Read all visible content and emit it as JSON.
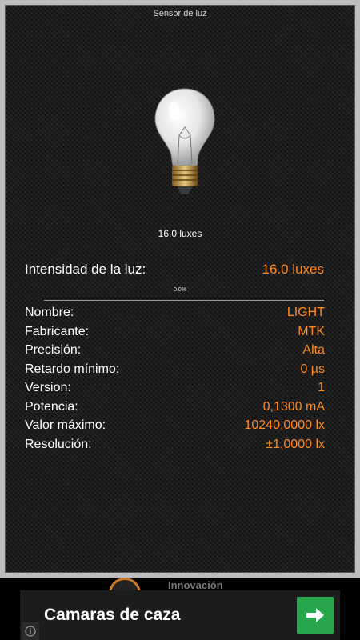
{
  "header": {
    "title": "Sensor de luz"
  },
  "bulb": {
    "caption": "16.0 luxes",
    "icon": "light-bulb-icon"
  },
  "intensity": {
    "label": "Intensidad de la luz:",
    "value": "16.0 luxes",
    "percent_text": "0.0%",
    "percent": 0.0
  },
  "details": [
    {
      "label": "Nombre:",
      "value": "LIGHT"
    },
    {
      "label": "Fabricante:",
      "value": "MTK"
    },
    {
      "label": "Precisión:",
      "value": "Alta"
    },
    {
      "label": "Retardo mínimo:",
      "value": "0 µs"
    },
    {
      "label": "Version:",
      "value": "1"
    },
    {
      "label": "Potencia:",
      "value": "0,1300 mA"
    },
    {
      "label": "Valor máximo:",
      "value": "10240,0000 lx"
    },
    {
      "label": "Resolución:",
      "value": "±1,0000 lx"
    }
  ],
  "ad": {
    "headline": "Camaras de caza",
    "top_text": "Innovación",
    "button_icon": "arrow-right-icon",
    "info_icon": "info-icon"
  },
  "colors": {
    "label_text": "#ffffff",
    "value_text": "#ff8a1e",
    "ad_button": "#27a64c"
  }
}
